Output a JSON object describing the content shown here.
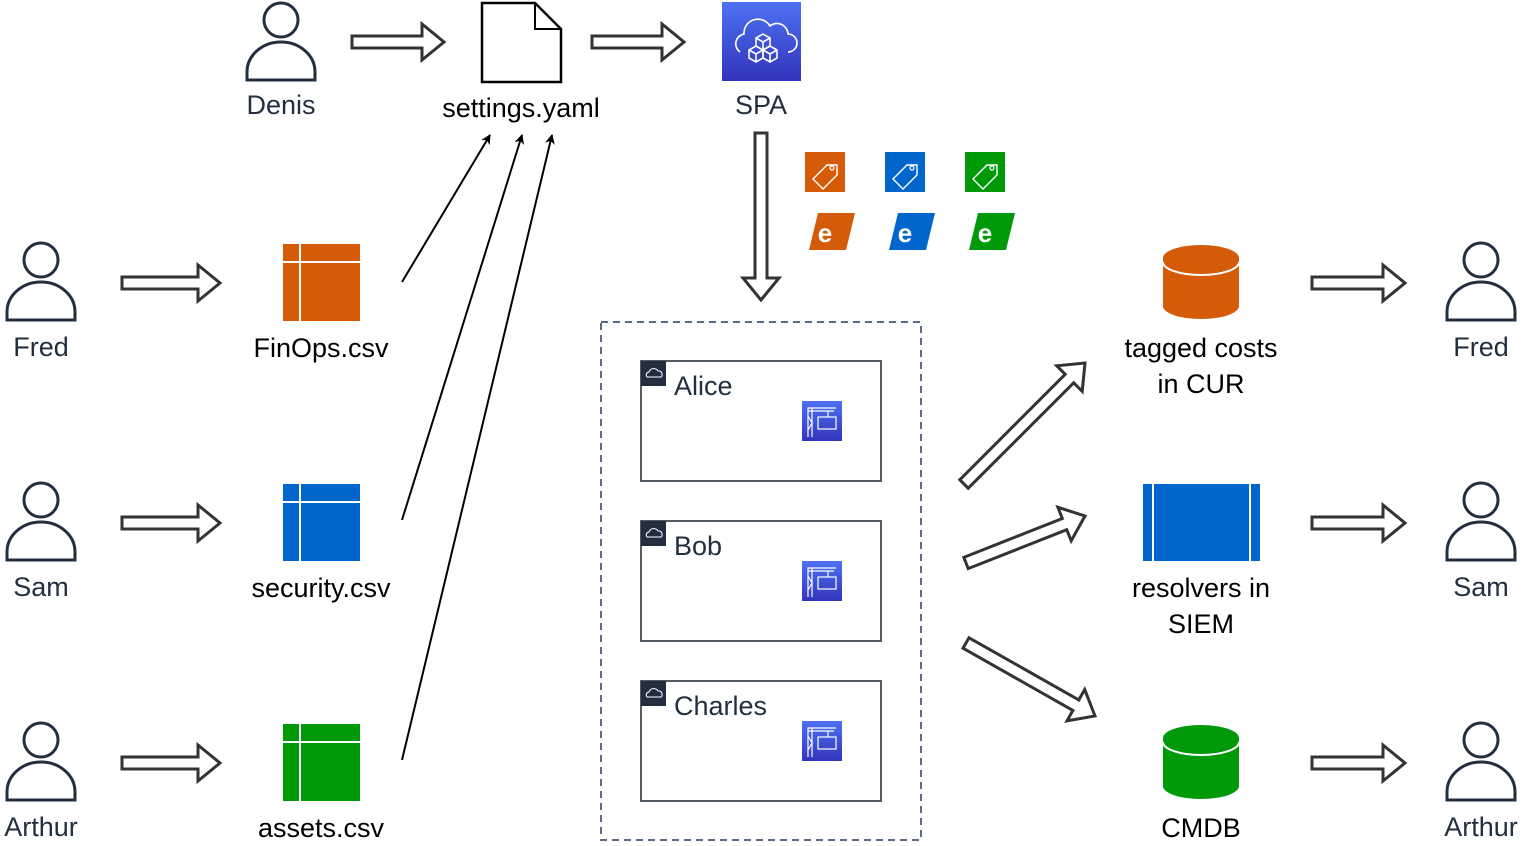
{
  "people": {
    "denis": "Denis",
    "fred_left": "Fred",
    "sam_left": "Sam",
    "arthur_left": "Arthur",
    "fred_right": "Fred",
    "sam_right": "Sam",
    "arthur_right": "Arthur"
  },
  "files": {
    "settings": "settings.yaml",
    "finops": "FinOps.csv",
    "security": "security.csv",
    "assets": "assets.csv"
  },
  "spa": {
    "label": "SPA",
    "icon": "cloud-cubes-icon"
  },
  "tags": [
    {
      "color": "#d45b07",
      "tag_icon": "tag-icon",
      "badge": "e"
    },
    {
      "color": "#0066cc",
      "tag_icon": "tag-icon",
      "badge": "e"
    },
    {
      "color": "#00990a",
      "tag_icon": "tag-icon",
      "badge": "e"
    }
  ],
  "accounts": [
    {
      "name": "Alice",
      "icon": "crane-code-icon"
    },
    {
      "name": "Bob",
      "icon": "crane-code-icon"
    },
    {
      "name": "Charles",
      "icon": "crane-code-icon"
    }
  ],
  "outputs": {
    "cur": {
      "line1": "tagged costs",
      "line2": "in CUR",
      "color": "#d45b07"
    },
    "siem": {
      "line1": "resolvers in",
      "line2": "SIEM",
      "color": "#0066cc"
    },
    "cmdb": {
      "line1": "CMDB",
      "color": "#00990a"
    }
  },
  "colors": {
    "orange": "#d45b07",
    "blue": "#0066cc",
    "green": "#00990a",
    "aws_purple": "#3f48cc",
    "stroke": "#333333"
  }
}
